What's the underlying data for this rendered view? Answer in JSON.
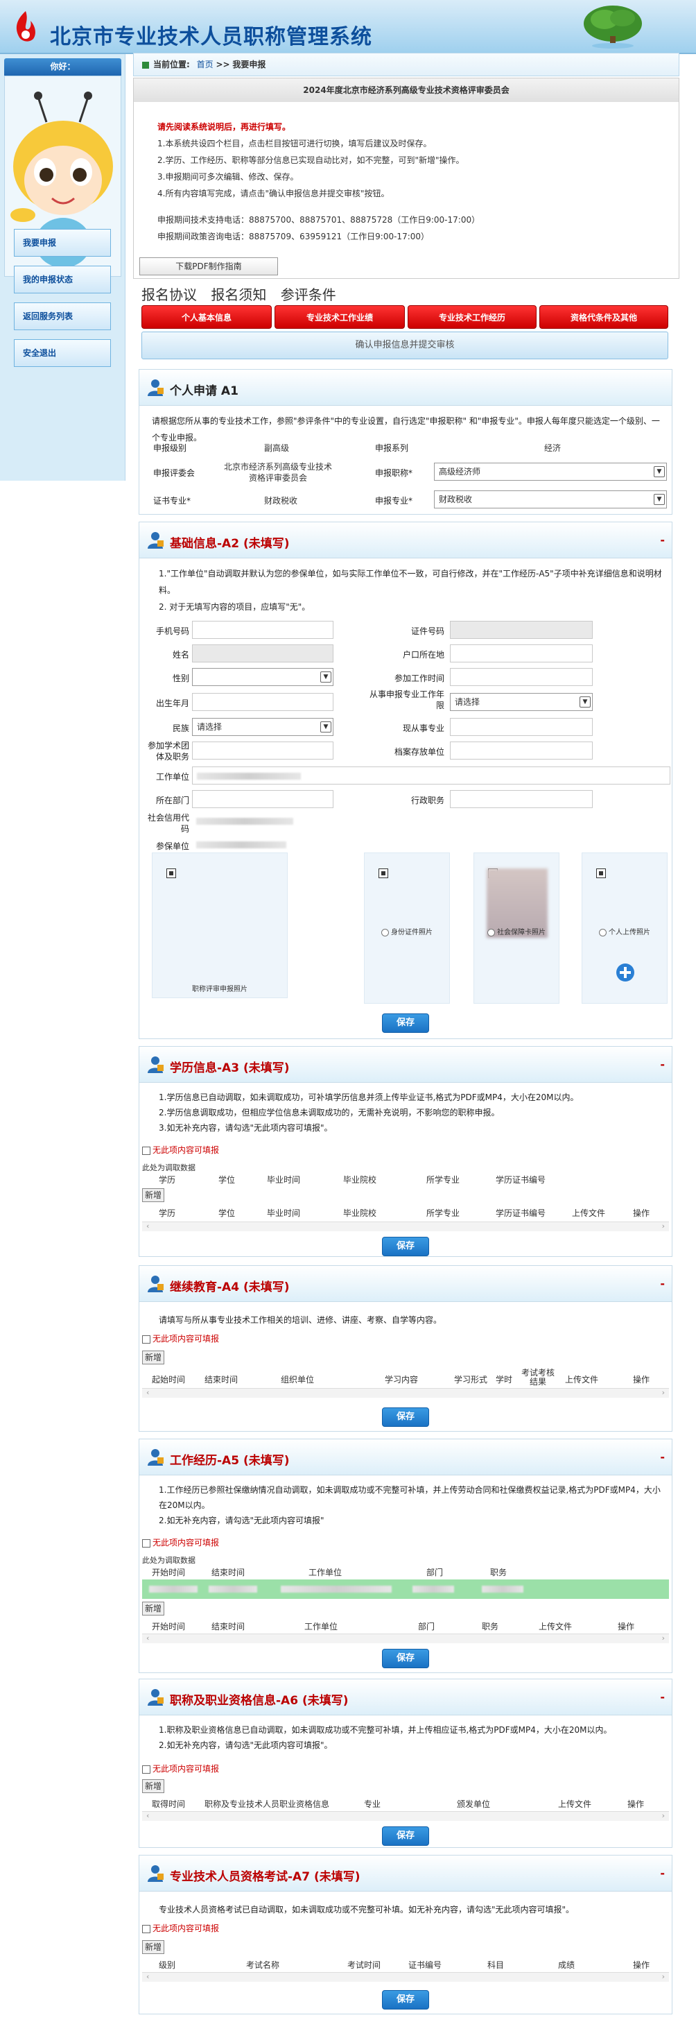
{
  "header": {
    "title": "北京市专业技术人员职称管理系统"
  },
  "sidebar": {
    "user_greeting": "你好：",
    "items": [
      {
        "label": "我要申报"
      },
      {
        "label": "我的申报状态"
      },
      {
        "label": "返回服务列表"
      },
      {
        "label": "安全退出"
      }
    ]
  },
  "breadcrumb": {
    "prefix": "当前位置:",
    "home": "首页",
    "sep": ">>",
    "current": "我要申报"
  },
  "notice": {
    "title": "2024年度北京市经济系列高级专业技术资格评审委员会",
    "warning": "请先阅读系统说明后，再进行填写。",
    "lines": [
      "1.本系统共设四个栏目，点击栏目按钮可进行切换，填写后建议及时保存。",
      "2.学历、工作经历、职称等部分信息已实现自动比对，如不完整，可到\"新增\"操作。",
      "3.申报期间可多次编辑、修改、保存。",
      "4.所有内容填写完成，请点击\"确认申报信息并提交审核\"按钮。"
    ],
    "phone1": "申报期间技术支持电话：88875700、88875701、88875728（工作日9:00-17:00）",
    "phone2": "申报期间政策咨询电话：88875709、63959121（工作日9:00-17:00）",
    "pdf_button": "下载PDF制作指南"
  },
  "link_tabs": [
    "报名协议",
    "报名须知",
    "参评条件"
  ],
  "red_tabs": [
    "个人基本信息",
    "专业技术工作业绩",
    "专业技术工作经历",
    "资格代条件及其他"
  ],
  "confirm_button": "确认申报信息并提交审核",
  "a1": {
    "title": "个人申请 A1",
    "note": "请根据您所从事的专业技术工作，参照\"参评条件\"中的专业设置，自行选定\"申报职称\" 和\"申报专业\"。申报人每年度只能选定一个级别、一个专业申报。",
    "rows": [
      {
        "l1": "申报级别",
        "v1": "副高级",
        "l2": "申报系列",
        "v2": "经济"
      },
      {
        "l1": "申报评委会",
        "v1": "北京市经济系列高级专业技术资格评审委员会",
        "l2": "申报职称*",
        "v2": "高级经济师"
      },
      {
        "l1": "证书专业*",
        "v1": "财政税收",
        "l2": "申报专业*",
        "v2": "财政税收"
      }
    ]
  },
  "a2": {
    "title": "基础信息-A2 (未填写)",
    "dash": "-",
    "notes": [
      "1.\"工作单位\"自动调取并默认为您的参保单位，如与实际工作单位不一致，可自行修改，并在\"工作经历-A5\"子项中补充详细信息和说明材料。",
      "2. 对于无填写内容的项目，应填写\"无\"。"
    ],
    "fields": {
      "phone": "手机号码",
      "id_no": "证件号码",
      "name": "姓名",
      "hukou": "户口所在地",
      "gender": "性别",
      "work_start": "参加工作时间",
      "birth": "出生年月",
      "years": "从事申报专业工作年限",
      "years_val": "请选择",
      "ethnic": "民族",
      "ethnic_val": "请选择",
      "current_field": "现从事专业",
      "party": "参加学术团体及职务",
      "archive": "档案存放单位",
      "unit": "工作单位",
      "dept": "所在部门",
      "admin_post": "行政职务",
      "credit_code": "社会信用代码",
      "insured": "参保单位"
    },
    "photos": [
      {
        "caption": "职称评审申报照片"
      },
      {
        "caption": "身份证件照片"
      },
      {
        "caption": "社会保障卡照片"
      },
      {
        "caption": "个人上传照片"
      }
    ],
    "save": "保存"
  },
  "a3": {
    "title": "学历信息-A3 (未填写)",
    "dash": "-",
    "notes": [
      "1.学历信息已自动调取，如未调取成功，可补填学历信息并须上传毕业证书,格式为PDF或MP4，大小在20M以内。",
      "2.学历信息调取成功，但相应学位信息未调取成功的，无需补充说明，不影响您的职称申报。",
      "3.如无补充内容，请勾选\"无此项内容可填报\"。"
    ],
    "checkbox": "无此项内容可填报",
    "fetched": "此处为调取数据",
    "cols1": [
      "学历",
      "学位",
      "毕业时间",
      "毕业院校",
      "所学专业",
      "学历证书编号"
    ],
    "add": "新增",
    "cols2": [
      "学历",
      "学位",
      "毕业时间",
      "毕业院校",
      "所学专业",
      "学历证书编号",
      "上传文件",
      "操作"
    ],
    "save": "保存"
  },
  "a4": {
    "title": "继续教育-A4 (未填写)",
    "dash": "-",
    "note": "请填写与所从事专业技术工作相关的培训、进修、讲座、考察、自学等内容。",
    "checkbox": "无此项内容可填报",
    "add": "新增",
    "cols": [
      "起始时间",
      "结束时间",
      "组织单位",
      "学习内容",
      "学习形式",
      "学时",
      "考试考核结果",
      "上传文件",
      "操作"
    ],
    "save": "保存"
  },
  "a5": {
    "title": "工作经历-A5 (未填写)",
    "dash": "-",
    "notes": [
      "1.工作经历已参照社保缴纳情况自动调取，如未调取成功或不完整可补填，并上传劳动合同和社保缴费权益记录,格式为PDF或MP4，大小在20M以内。",
      "2.如无补充内容，请勾选\"无此项内容可填报\""
    ],
    "checkbox": "无此项内容可填报",
    "fetched": "此处为调取数据",
    "cols1": [
      "开始时间",
      "结束时间",
      "工作单位",
      "部门",
      "职务"
    ],
    "add": "新增",
    "cols2": [
      "开始时间",
      "结束时间",
      "工作单位",
      "部门",
      "职务",
      "上传文件",
      "操作"
    ],
    "save": "保存"
  },
  "a6": {
    "title": "职称及职业资格信息-A6 (未填写)",
    "dash": "-",
    "notes": [
      "1.职称及职业资格信息已自动调取，如未调取成功或不完整可补填，并上传相应证书,格式为PDF或MP4，大小在20M以内。",
      "2.如无补充内容，请勾选\"无此项内容可填报\"。"
    ],
    "checkbox": "无此项内容可填报",
    "add": "新增",
    "cols": [
      "取得时间",
      "职称及专业技术人员职业资格信息",
      "专业",
      "颁发单位",
      "上传文件",
      "操作"
    ],
    "save": "保存"
  },
  "a7": {
    "title": "专业技术人员资格考试-A7 (未填写)",
    "dash": "-",
    "note": "专业技术人员资格考试已自动调取，如未调取成功或不完整可补填。如无补充内容，请勾选\"无此项内容可填报\"。",
    "checkbox": "无此项内容可填报",
    "add": "新增",
    "cols": [
      "级别",
      "考试名称",
      "考试时间",
      "证书编号",
      "科目",
      "成绩",
      "操作"
    ],
    "save": "保存"
  },
  "colors": {
    "brand_blue": "#0d4f9c",
    "section_red": "#b00000",
    "tab_red": "#e02020",
    "save_blue": "#1a72c4",
    "highlight_green": "#9be0a8"
  }
}
